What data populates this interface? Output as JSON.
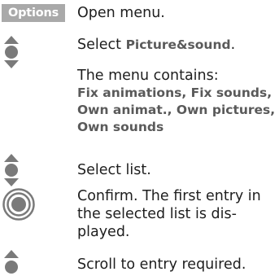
{
  "softkey": {
    "label": "Options"
  },
  "steps": [
    {
      "text": "Open menu."
    },
    {
      "prefix": "Select ",
      "bold": "Picture&sound",
      "suffix": "."
    },
    {
      "text": "The menu contains:"
    },
    {
      "text": "Select list."
    },
    {
      "text": "Confirm. The first entry in the selected list is dis-played."
    },
    {
      "text": "Scroll to entry required."
    }
  ],
  "menu_items": [
    "Fix animations, Fix sounds,",
    "Own animat., Own pictures,",
    "Own sounds"
  ],
  "icons": {
    "navigate": "joystick-up-down-icon",
    "confirm": "joystick-center-press-icon",
    "scroll": "joystick-up-down-icon"
  },
  "colors": {
    "softkey_bg": "#a9a9a9",
    "bold_text": "#5a5a5a",
    "icon": "#7a7a7a"
  }
}
